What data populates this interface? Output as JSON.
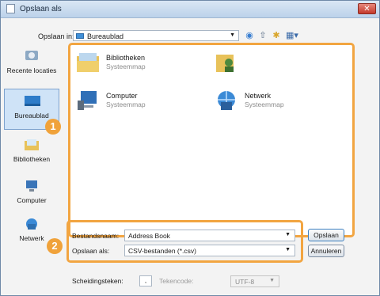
{
  "window": {
    "title": "Opslaan als",
    "close_label": "✕"
  },
  "toolbar": {
    "save_in_label": "Opslaan in:",
    "location": "Bureaublad"
  },
  "sidebar": {
    "items": [
      {
        "label": "Recente locaties",
        "icon": "recent-places-icon"
      },
      {
        "label": "Bureaublad",
        "icon": "desktop-icon",
        "selected": true
      },
      {
        "label": "Bibliotheken",
        "icon": "libraries-icon"
      },
      {
        "label": "Computer",
        "icon": "computer-icon"
      },
      {
        "label": "Netwerk",
        "icon": "network-icon"
      }
    ]
  },
  "files": [
    {
      "name": "Bibliotheken",
      "type": "Systeemmap",
      "icon": "libraries-folder-icon"
    },
    {
      "name": "",
      "type": "",
      "icon": "user-folder-icon"
    },
    {
      "name": "Computer",
      "type": "Systeemmap",
      "icon": "computer-icon"
    },
    {
      "name": "Netwerk",
      "type": "Systeemmap",
      "icon": "network-icon"
    }
  ],
  "form": {
    "filename_label": "Bestandsnaam:",
    "filename_value": "Address Book",
    "save_as_label": "Opslaan als:",
    "save_as_value": "CSV-bestanden (*.csv)",
    "save_button": "Opslaan",
    "cancel_button": "Annuleren"
  },
  "badges": {
    "one": "1",
    "two": "2"
  },
  "options": {
    "separator_label": "Scheidingsteken:",
    "separator_value": ",",
    "encoding_label": "Tekencode:",
    "encoding_value": "UTF-8"
  },
  "colors": {
    "highlight": "#f2a541",
    "titlebar": "#bcd2ea",
    "close": "#c4392b"
  }
}
